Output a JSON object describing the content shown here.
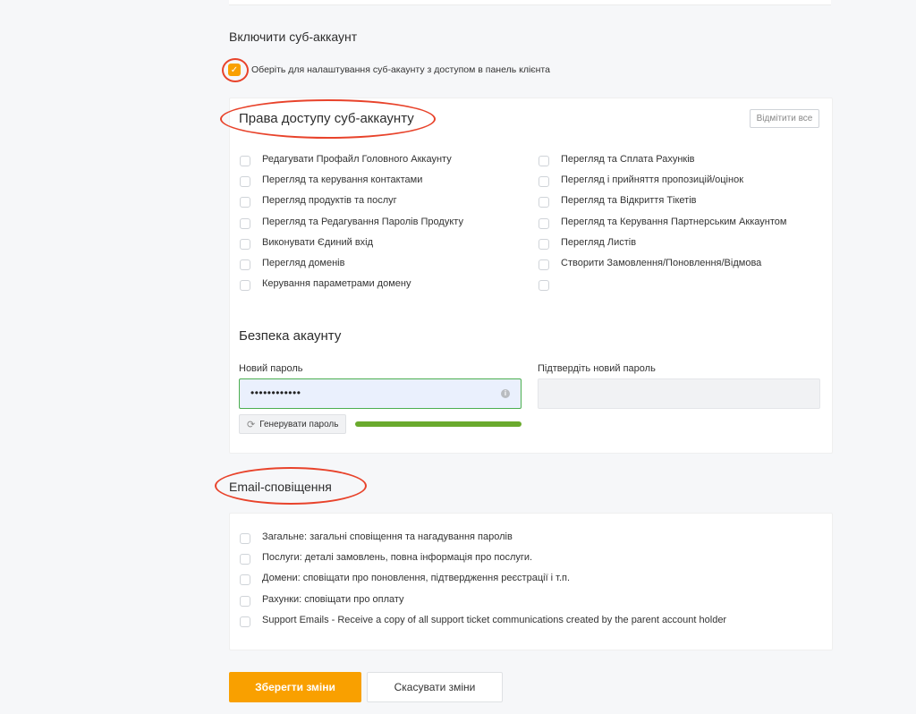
{
  "subaccount": {
    "title": "Включити суб-аккаунт",
    "checkbox_label": "Оберіть для налаштування суб-акаунту з доступом в панель клієнта",
    "checked": true
  },
  "permissions": {
    "title": "Права доступу суб-аккаунту",
    "uncheck_all_label": "Відмітити все",
    "left": [
      "Редагувати Профайл Головного Аккаунту",
      "Перегляд та керування контактами",
      "Перегляд продуктів та послуг",
      "Перегляд та Редагування Паролів Продукту",
      "Виконувати Єдиний вхід",
      "Перегляд доменів",
      "Керування параметрами домену"
    ],
    "right": [
      "Перегляд та Сплата Рахунків",
      "Перегляд і прийняття пропозицій/оцінок",
      "Перегляд та Відкриття Тікетів",
      "Перегляд та Керування Партнерським Аккаунтом",
      "Перегляд Листів",
      "Створити Замовлення/Поновлення/Відмова",
      ""
    ]
  },
  "security": {
    "title": "Безпека акаунту",
    "new_password_label": "Новий пароль",
    "new_password_value": "••••••••••••",
    "confirm_password_label": "Підтвердіть новий пароль",
    "generate_label": "Генерувати пароль",
    "strength": 1.0,
    "strength_color": "#6aaa2d"
  },
  "email": {
    "title": "Email-сповіщення",
    "items": [
      "Загальне: загальні сповіщення та нагадування паролів",
      "Послуги: деталі замовлень, повна інформація про послуги.",
      "Домени: сповіщати про поновлення, підтвердження реєстрації і т.п.",
      "Рахунки: сповіщати про оплату",
      "Support Emails - Receive a copy of all support ticket communications created by the parent account holder"
    ]
  },
  "actions": {
    "save_label": "Зберегти зміни",
    "cancel_label": "Скасувати зміни"
  },
  "colors": {
    "accent": "#f9a000",
    "annotation": "#e8432b"
  }
}
